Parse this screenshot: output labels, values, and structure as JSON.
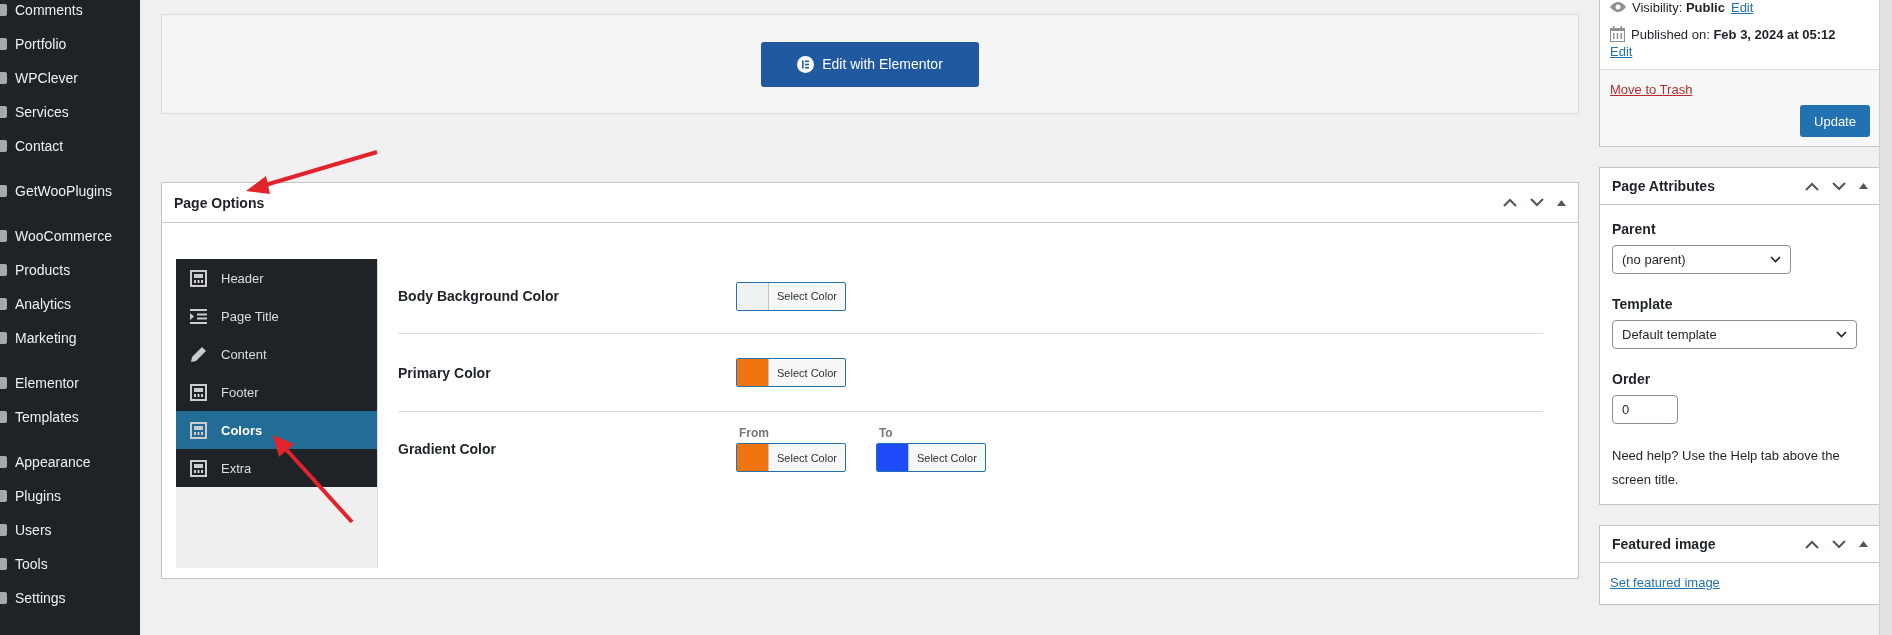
{
  "admin_menu": {
    "groups": [
      {
        "items": [
          {
            "label": "Comments"
          },
          {
            "label": "Portfolio"
          },
          {
            "label": "WPClever"
          },
          {
            "label": "Services"
          },
          {
            "label": "Contact"
          }
        ]
      },
      {
        "items": [
          {
            "label": "GetWooPlugins"
          }
        ]
      },
      {
        "items": [
          {
            "label": "WooCommerce"
          },
          {
            "label": "Products"
          },
          {
            "label": "Analytics"
          },
          {
            "label": "Marketing"
          }
        ]
      },
      {
        "items": [
          {
            "label": "Elementor"
          },
          {
            "label": "Templates"
          }
        ]
      },
      {
        "items": [
          {
            "label": "Appearance"
          },
          {
            "label": "Plugins"
          },
          {
            "label": "Users"
          },
          {
            "label": "Tools"
          },
          {
            "label": "Settings"
          }
        ]
      }
    ]
  },
  "editor_box": {
    "button": "Edit with Elementor"
  },
  "page_options": {
    "title": "Page Options",
    "tabs": [
      {
        "label": "Header",
        "kind": "layout",
        "selected": false
      },
      {
        "label": "Page Title",
        "kind": "title",
        "selected": false
      },
      {
        "label": "Content",
        "kind": "content",
        "selected": false
      },
      {
        "label": "Footer",
        "kind": "layout",
        "selected": false
      },
      {
        "label": "Colors",
        "kind": "layout",
        "selected": true
      },
      {
        "label": "Extra",
        "kind": "layout",
        "selected": false
      }
    ],
    "fields": [
      {
        "label": "Body Background Color",
        "pickers": [
          {
            "button": "Select Color",
            "color": "#f0f2f1"
          }
        ]
      },
      {
        "label": "Primary Color",
        "pickers": [
          {
            "button": "Select Color",
            "color": "#ef730e"
          }
        ]
      },
      {
        "label": "Gradient Color",
        "pickers": [
          {
            "caption": "From",
            "button": "Select Color",
            "color": "#ef730e"
          },
          {
            "caption": "To",
            "button": "Select Color",
            "color": "#1f4cfa"
          }
        ]
      }
    ]
  },
  "publish": {
    "visibility_label": "Visibility:",
    "visibility_value": "Public",
    "visibility_edit": "Edit",
    "published_label": "Published on:",
    "published_value": "Feb 3, 2024 at 05:12",
    "published_edit": "Edit",
    "trash": "Move to Trash",
    "update": "Update"
  },
  "page_attributes": {
    "title": "Page Attributes",
    "parent_label": "Parent",
    "parent_value": "(no parent)",
    "template_label": "Template",
    "template_value": "Default template",
    "order_label": "Order",
    "order_value": "0",
    "help": "Need help? Use the Help tab above the screen title."
  },
  "featured_image": {
    "title": "Featured image",
    "link": "Set featured image"
  }
}
